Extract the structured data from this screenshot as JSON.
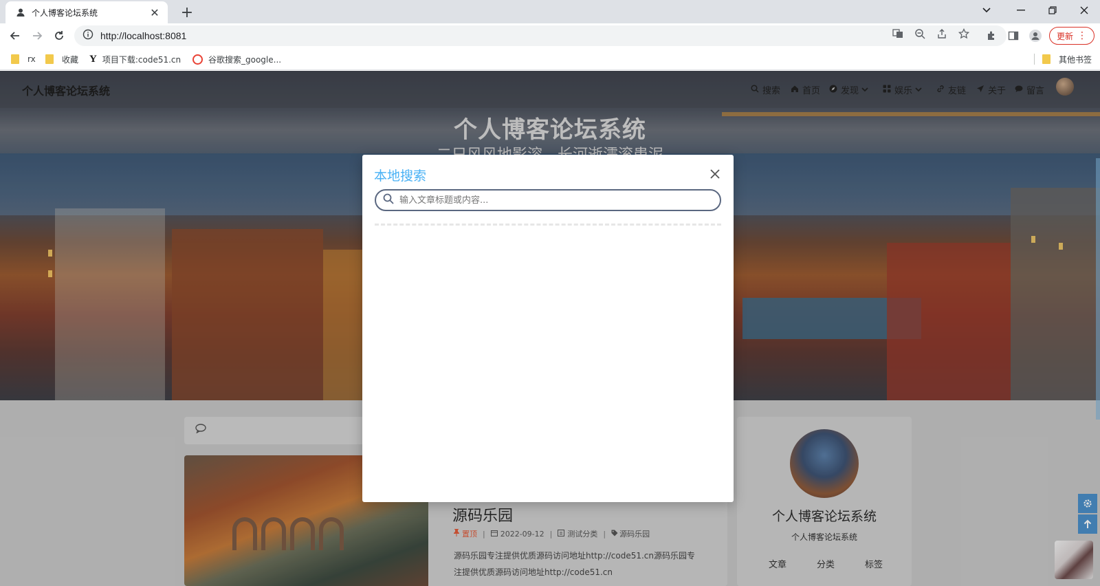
{
  "browser": {
    "tab_title": "个人博客论坛系统",
    "url": "http://localhost:8081",
    "update_label": "更新",
    "bookmarks": [
      {
        "label": "rx"
      },
      {
        "label": "收藏"
      },
      {
        "label": "项目下载:code51.cn"
      },
      {
        "label": "谷歌搜索_google..."
      }
    ],
    "other_bookmarks": "其他书签"
  },
  "site": {
    "brand": "个人博客论坛系统",
    "nav": [
      {
        "label": "搜索",
        "icon": "search-icon"
      },
      {
        "label": "首页",
        "icon": "home-icon"
      },
      {
        "label": "发现",
        "icon": "compass-icon",
        "dropdown": true
      },
      {
        "label": "娱乐",
        "icon": "grid-icon",
        "dropdown": true
      },
      {
        "label": "友链",
        "icon": "link-icon"
      },
      {
        "label": "关于",
        "icon": "send-icon"
      },
      {
        "label": "留言",
        "icon": "comment-icon"
      }
    ],
    "hero_title": "个人博客论坛系统",
    "hero_subtitle": "二只风风地影溶，长河逝濡滚患泥"
  },
  "post": {
    "title": "源码乐园",
    "pinned_label": "置顶",
    "date": "2022-09-12",
    "category": "测试分类",
    "tag": "源码乐园",
    "summary": "源码乐园专注提供优质源码访问地址http://code51.cn源码乐园专注提供优质源码访问地址http://code51.cn"
  },
  "profile": {
    "name": "个人博客论坛系统",
    "subtitle": "个人博客论坛系统",
    "stats": [
      {
        "label": "文章"
      },
      {
        "label": "分类"
      },
      {
        "label": "标签"
      }
    ]
  },
  "search_modal": {
    "title": "本地搜索",
    "placeholder": "输入文章标题或内容...",
    "value": ""
  },
  "colors": {
    "accent": "#49b1f5",
    "pin": "#e05a3a"
  }
}
